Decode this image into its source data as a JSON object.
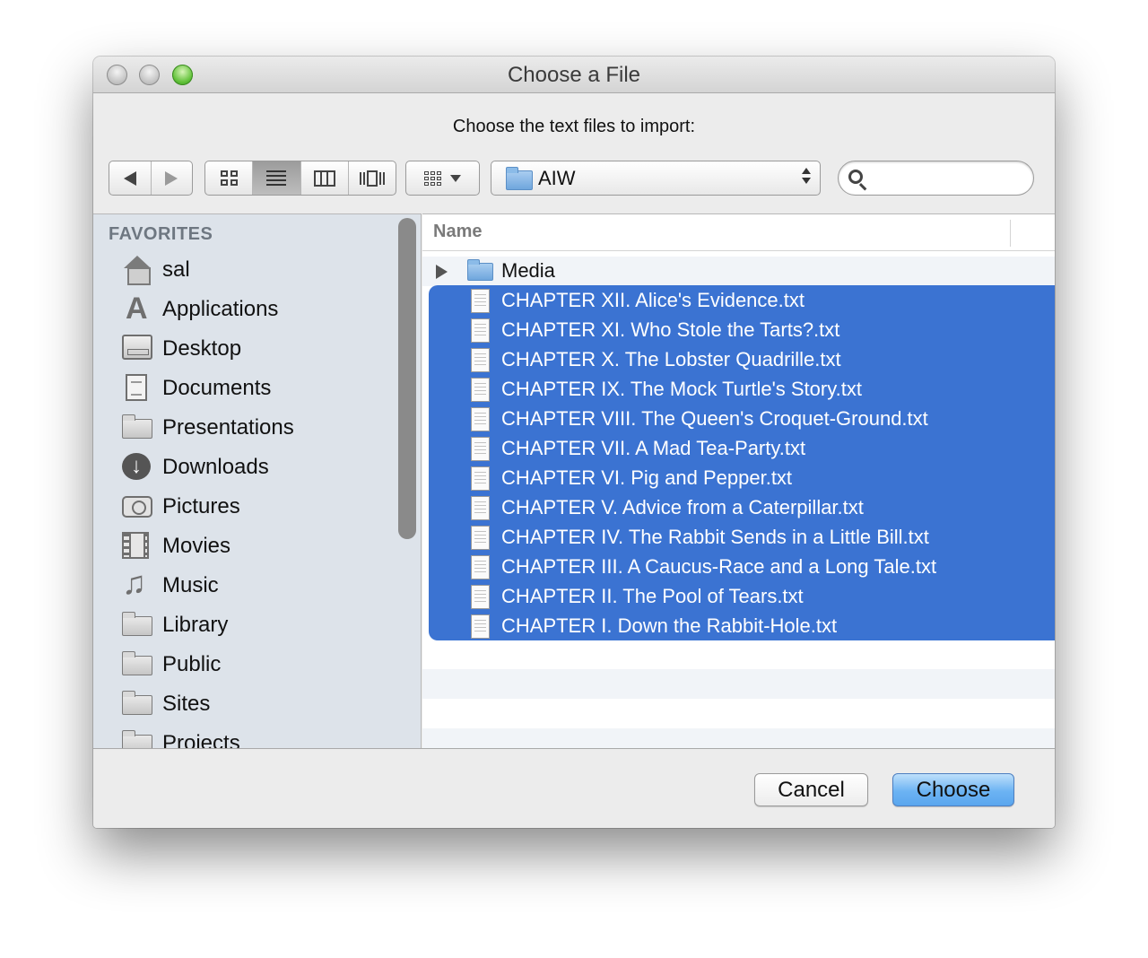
{
  "window": {
    "title": "Choose a File",
    "prompt": "Choose the text files to import:"
  },
  "toolbar": {
    "path_popup_label": "AIW",
    "search_placeholder": "",
    "search_value": ""
  },
  "sidebar": {
    "header": "FAVORITES",
    "items": [
      {
        "label": "sal",
        "icon": "home-icon"
      },
      {
        "label": "Applications",
        "icon": "applications-icon"
      },
      {
        "label": "Desktop",
        "icon": "desktop-icon"
      },
      {
        "label": "Documents",
        "icon": "documents-icon"
      },
      {
        "label": "Presentations",
        "icon": "folder-icon"
      },
      {
        "label": "Downloads",
        "icon": "downloads-icon"
      },
      {
        "label": "Pictures",
        "icon": "camera-icon"
      },
      {
        "label": "Movies",
        "icon": "film-icon"
      },
      {
        "label": "Music",
        "icon": "music-note-icon"
      },
      {
        "label": "Library",
        "icon": "folder-icon"
      },
      {
        "label": "Public",
        "icon": "folder-icon"
      },
      {
        "label": "Sites",
        "icon": "folder-icon"
      },
      {
        "label": "Projects",
        "icon": "folder-icon"
      }
    ]
  },
  "filelist": {
    "column_name": "Name",
    "folder": {
      "label": "Media",
      "icon": "folder-icon"
    },
    "files": [
      "CHAPTER XII. Alice's Evidence.txt",
      "CHAPTER XI. Who Stole the Tarts?.txt",
      "CHAPTER X. The Lobster Quadrille.txt",
      "CHAPTER IX. The Mock Turtle's Story.txt",
      "CHAPTER VIII. The Queen's Croquet-Ground.txt",
      "CHAPTER VII. A Mad Tea-Party.txt",
      "CHAPTER VI. Pig and Pepper.txt",
      "CHAPTER V. Advice from a Caterpillar.txt",
      "CHAPTER IV. The Rabbit Sends in a Little Bill.txt",
      "CHAPTER III. A Caucus-Race and a Long Tale.txt",
      "CHAPTER II. The Pool of Tears.txt",
      "CHAPTER I. Down the Rabbit-Hole.txt"
    ],
    "selection_color": "#3b73d2"
  },
  "buttons": {
    "cancel": "Cancel",
    "choose": "Choose"
  }
}
